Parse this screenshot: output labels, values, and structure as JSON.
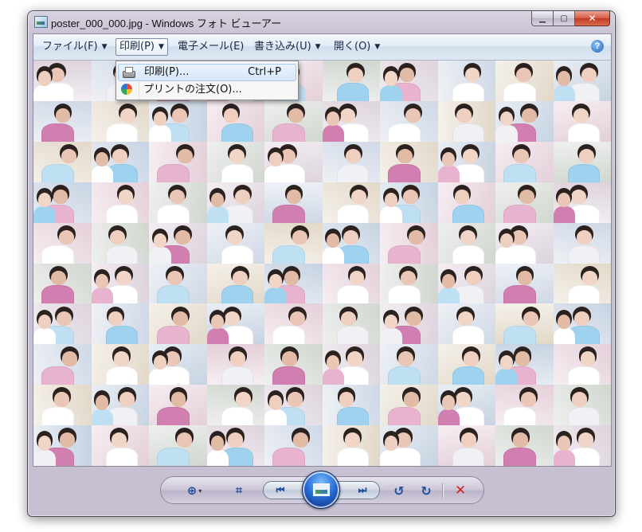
{
  "window": {
    "title": "poster_000_000.jpg - Windows フォト ビューアー",
    "buttons": {
      "minimize": "▁",
      "maximize": "▢",
      "close": "✕"
    }
  },
  "toolbar": {
    "menus": [
      {
        "label": "ファイル(F)",
        "has_dropdown": true
      },
      {
        "label": "印刷(P)",
        "has_dropdown": true,
        "active": true
      },
      {
        "label": "電子メール(E)",
        "has_dropdown": false
      },
      {
        "label": "書き込み(U)",
        "has_dropdown": true
      },
      {
        "label": "開く(O)",
        "has_dropdown": true
      }
    ],
    "dropdown_arrow": "▼",
    "help_icon": "help-icon"
  },
  "print_menu": {
    "items": [
      {
        "label": "印刷(P)...",
        "shortcut": "Ctrl+P",
        "icon": "printer-icon",
        "highlighted": true
      },
      {
        "label": "プリントの注文(O)...",
        "shortcut": "",
        "icon": "order-prints-icon",
        "highlighted": false
      }
    ]
  },
  "controls": {
    "zoom_icon": "⊕",
    "zoom_caret": "▾",
    "fit_icon": "⌗",
    "prev_icon": "⏮",
    "next_icon": "⏭",
    "rotate_left_icon": "↺",
    "rotate_right_icon": "↻",
    "delete_icon": "✕"
  },
  "colors": {
    "window_frame": "#c9c2d4",
    "toolbar": "#dfe8f3",
    "accent_blue": "#2a6fd6",
    "delete_red": "#d42020"
  }
}
